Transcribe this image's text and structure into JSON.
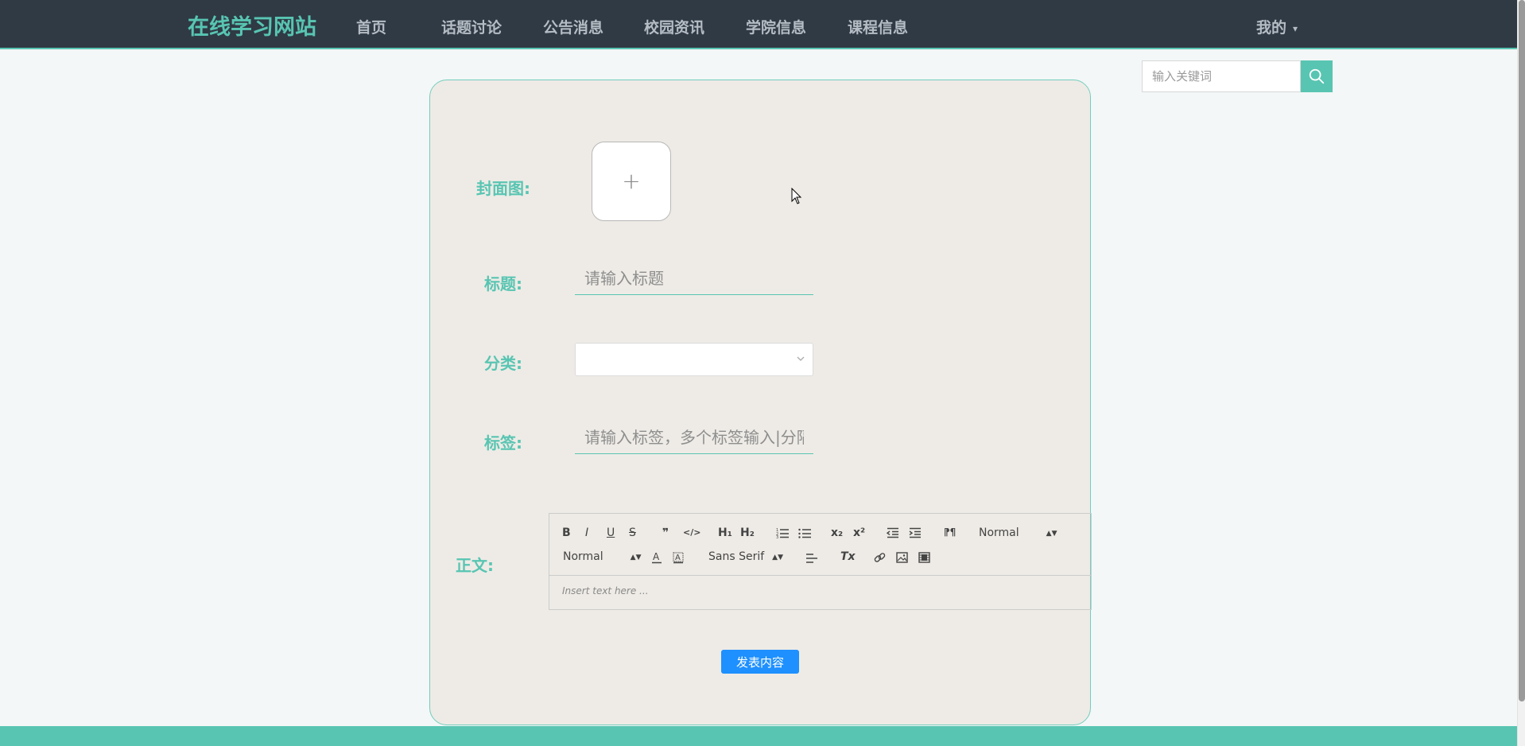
{
  "nav": {
    "brand": "在线学习网站",
    "items": [
      {
        "label": "首页"
      },
      {
        "label": "话题讨论"
      },
      {
        "label": "公告消息"
      },
      {
        "label": "校园资讯"
      },
      {
        "label": "学院信息"
      },
      {
        "label": "课程信息"
      }
    ],
    "me": "我的"
  },
  "search": {
    "placeholder": "输入关键词",
    "icon": "search-icon"
  },
  "form": {
    "cover_label": "封面图:",
    "cover_upload_icon": "+",
    "title_label": "标题:",
    "title_placeholder": "请输入标题",
    "category_label": "分类:",
    "category_value": "",
    "tags_label": "标签:",
    "tags_placeholder": "请输入标签，多个标签输入|分隔",
    "body_label": "正文:",
    "submit_label": "发表内容"
  },
  "editor": {
    "toolbar": {
      "bold": "B",
      "italic": "I",
      "underline": "U",
      "strike": "S",
      "blockquote": "❞",
      "code": "</>",
      "h1": "H₁",
      "h2": "H₂",
      "subscript": "x₂",
      "superscript": "x²",
      "rtl": "⁋¶",
      "header_picker": "Normal",
      "size_picker": "Normal",
      "font_picker": "Sans Serif",
      "clean": "Tx"
    },
    "placeholder": "Insert text here ..."
  },
  "colors": {
    "topbar": "#2f3a45",
    "accent": "#58c5b2",
    "card": "#eeebe6",
    "submit": "#1e90ff"
  }
}
